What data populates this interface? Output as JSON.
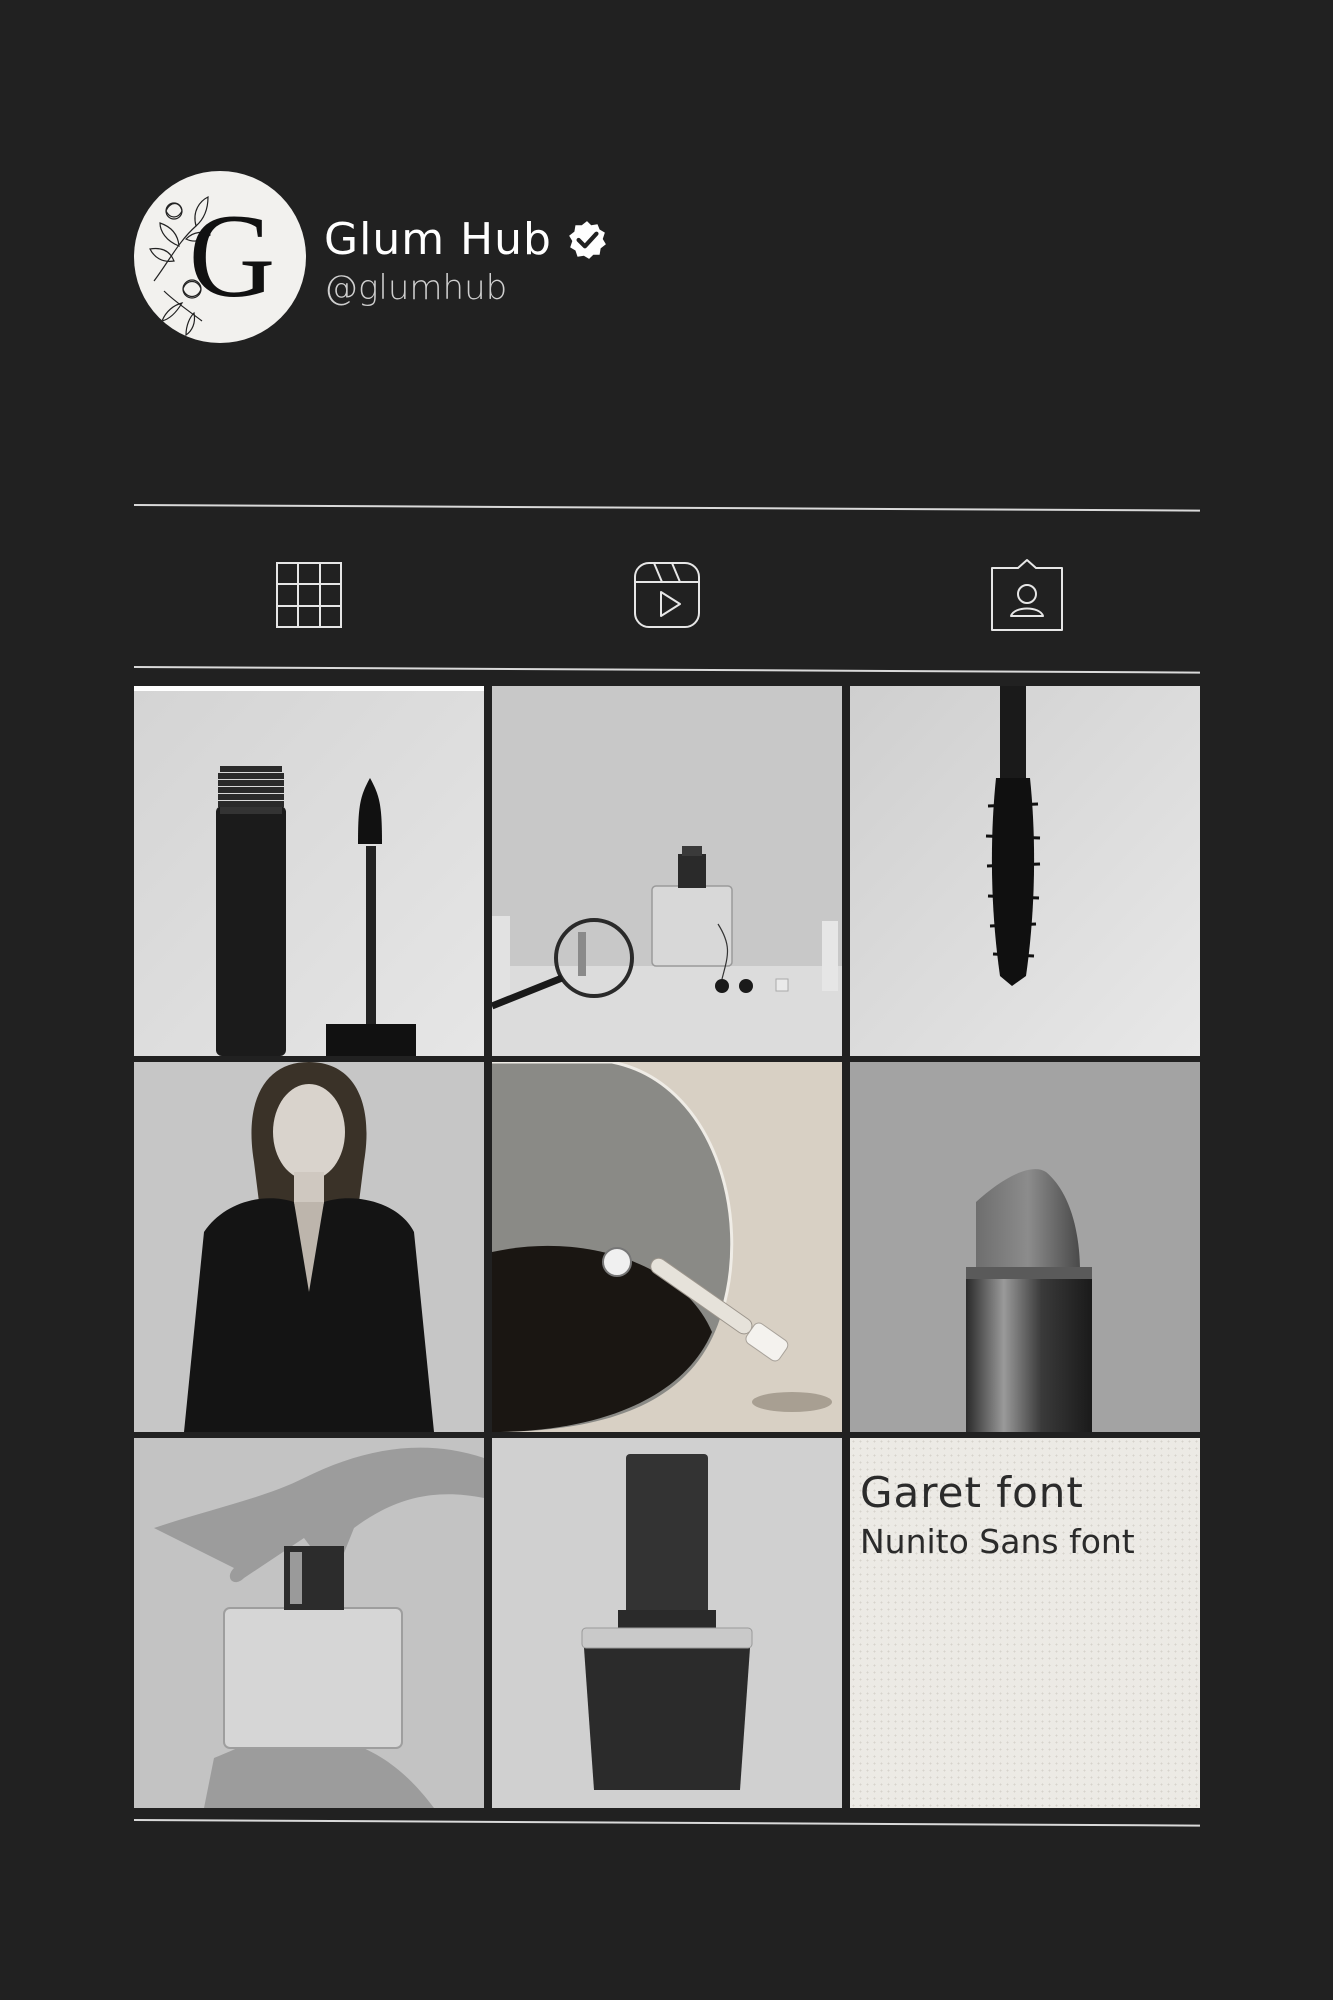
{
  "profile": {
    "name": "Glum Hub",
    "handle": "@glumhub",
    "avatar_letter": "G",
    "verified_icon": "verified-badge-icon"
  },
  "tabs": [
    {
      "icon": "grid-icon",
      "active": true
    },
    {
      "icon": "reels-icon",
      "active": false
    },
    {
      "icon": "tagged-icon",
      "active": false
    }
  ],
  "posts": [
    {
      "subject": "mascara-tube-and-wand"
    },
    {
      "subject": "magnifier-and-perfume-bottle"
    },
    {
      "subject": "mascara-brush"
    },
    {
      "subject": "woman-in-black-blazer"
    },
    {
      "subject": "mirror-and-dropper"
    },
    {
      "subject": "lipstick"
    },
    {
      "subject": "perfume-with-hand-shadows"
    },
    {
      "subject": "nail-polish-bottle"
    },
    {
      "subject": "text-card",
      "title": "Garet font",
      "subtitle": "Nunito Sans font"
    }
  ],
  "colors": {
    "background": "#212121",
    "text_primary": "#ffffff",
    "text_secondary": "#cfcfcf",
    "divider": "#d9d9d9"
  }
}
